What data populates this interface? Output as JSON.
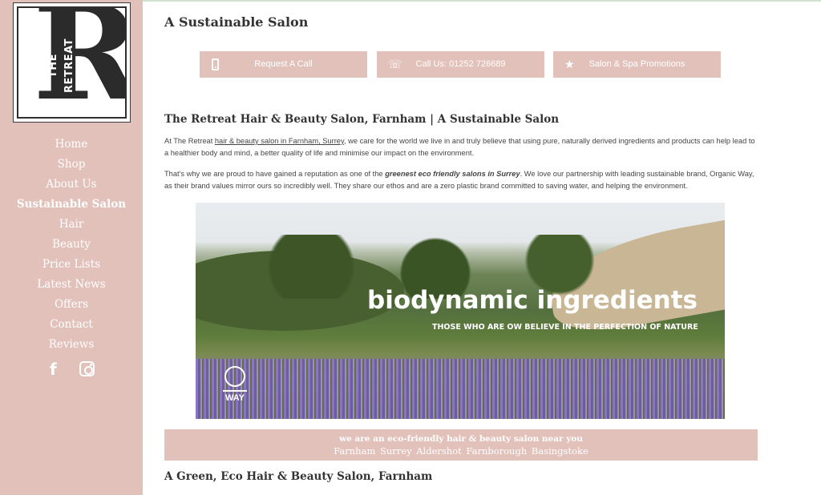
{
  "logo": {
    "letter": "R",
    "text": "THE RETREAT"
  },
  "sidebar": {
    "nav": [
      {
        "label": "Home",
        "active": false
      },
      {
        "label": "Shop",
        "active": false
      },
      {
        "label": "About Us",
        "active": false
      },
      {
        "label": "Sustainable Salon",
        "active": true
      },
      {
        "label": "Hair",
        "active": false
      },
      {
        "label": "Beauty",
        "active": false
      },
      {
        "label": "Price Lists",
        "active": false
      },
      {
        "label": "Latest News",
        "active": false
      },
      {
        "label": "Offers",
        "active": false
      },
      {
        "label": "Contact",
        "active": false
      },
      {
        "label": "Reviews",
        "active": false
      }
    ],
    "social": {
      "facebook": "f"
    }
  },
  "main": {
    "page_title": "A Sustainable Salon",
    "buttons": [
      {
        "label": "Request A Call",
        "icon": "mobile-phone-icon"
      },
      {
        "label": "Call Us: 01252 726689",
        "icon": "phone-volume-icon",
        "glyph": "((·))"
      },
      {
        "label": "Salon & Spa Promotions",
        "icon": "star-icon",
        "glyph": "★"
      }
    ],
    "heading": "The Retreat Hair & Beauty Salon, Farnham | A Sustainable Salon",
    "para1": {
      "before": "At The Retreat ",
      "link": "hair & beauty salon in Farnham, Surrey",
      "after": ", we care for the world we live in and truly believe that using pure, naturally derived ingredients and products can help lead to a healthier body and mind, a better quality of life and minimise our impact on the environment."
    },
    "para2": {
      "before": "That's why we are proud to have gained a reputation as one of the ",
      "bold": "greenest eco friendly salons in Surrey",
      "after": ". We love our partnership with leading sustainable brand, Organic Way, as their brand values mirror ours so incredibly well. They share our ethos and are a zero plastic brand committed to saving water, and helping the environment."
    },
    "banner": {
      "title": "biodynamic ingredients",
      "subtitle": "THOSE WHO ARE OW BELIEVE IN THE PERFECTION OF NATURE",
      "logo_letter": "O",
      "logo_word": "WAY"
    },
    "eco_box": {
      "line1": "we are an eco-friendly hair & beauty  salon near you",
      "line2": "Farnham  Surrey  Aldershot  Farnborough  Basingstoke"
    },
    "heading3": "A Green, Eco Hair & Beauty Salon, Farnham"
  },
  "colors": {
    "accent": "#e2c1bb",
    "text": "#333333"
  }
}
